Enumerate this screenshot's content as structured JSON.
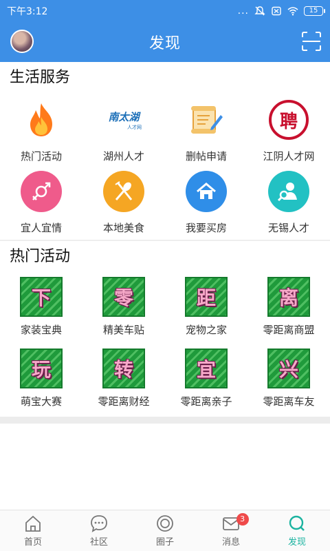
{
  "status_bar": {
    "time": "下午3:12",
    "signal_dots": "...",
    "battery": "15"
  },
  "header": {
    "title": "发现"
  },
  "life_services": {
    "title": "生活服务",
    "items": [
      {
        "label": "热门活动",
        "icon": "flame-icon",
        "color": "#ff7a1a"
      },
      {
        "label": "湖州人才",
        "icon": "nantaihu-logo",
        "logo_text": "南太湖",
        "logo_sub": "人才网",
        "color": "#1c6fb8"
      },
      {
        "label": "删帖申请",
        "icon": "scroll-edit-icon",
        "color": "#e6a23c"
      },
      {
        "label": "江阴人才网",
        "icon": "pin-logo",
        "logo_text": "聘",
        "color": "#c8102e"
      },
      {
        "label": "宜人宜情",
        "icon": "gender-icon",
        "color": "#ef5b8b"
      },
      {
        "label": "本地美食",
        "icon": "fork-spoon-icon",
        "color": "#f5a623"
      },
      {
        "label": "我要买房",
        "icon": "house-icon",
        "color": "#2f8ee8"
      },
      {
        "label": "无锡人才",
        "icon": "user-search-icon",
        "color": "#22c1c3"
      }
    ]
  },
  "hot_activities": {
    "title": "热门活动",
    "items": [
      {
        "label": "家装宝典",
        "char": "下"
      },
      {
        "label": "精美车贴",
        "char": "零"
      },
      {
        "label": "宠物之家",
        "char": "距"
      },
      {
        "label": "零距离商盟",
        "char": "离"
      },
      {
        "label": "萌宝大赛",
        "char": "玩"
      },
      {
        "label": "零距离财经",
        "char": "转"
      },
      {
        "label": "零距离亲子",
        "char": "宜"
      },
      {
        "label": "零距离车友",
        "char": "兴"
      }
    ]
  },
  "bottom_nav": {
    "items": [
      {
        "label": "首页",
        "icon": "home-icon"
      },
      {
        "label": "社区",
        "icon": "chat-bubble-icon"
      },
      {
        "label": "圈子",
        "icon": "circle-icon"
      },
      {
        "label": "消息",
        "icon": "mail-icon",
        "badge": "3"
      },
      {
        "label": "发现",
        "icon": "search-icon",
        "active": true
      }
    ]
  },
  "colors": {
    "header": "#3d8fe6",
    "active_nav": "#1bb3a0",
    "badge": "#ef4a4a"
  }
}
